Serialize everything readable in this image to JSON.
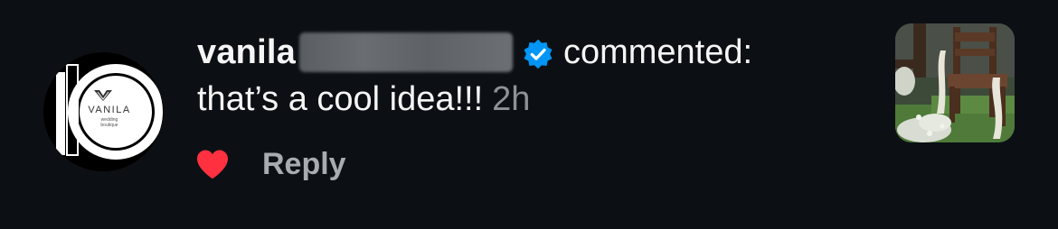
{
  "comment": {
    "username": "vanila",
    "action": "commented:",
    "text": "that’s a cool idea!!!",
    "time": "2h",
    "reply_label": "Reply",
    "liked": true
  },
  "avatar": {
    "brand": "VANILA",
    "tagline_1": "wedding",
    "tagline_2": "boutique"
  },
  "icons": {
    "verified": "verified-badge-icon",
    "like": "heart-icon"
  },
  "colors": {
    "background": "#0c1014",
    "verified": "#0095f6",
    "like": "#ff3040",
    "secondary_text": "#8e9196"
  }
}
